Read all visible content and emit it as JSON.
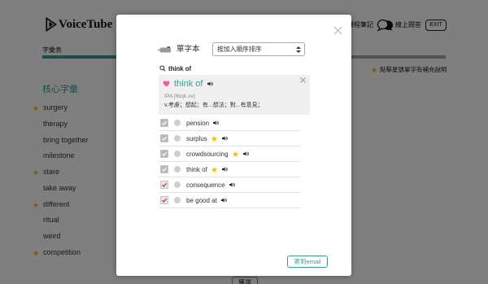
{
  "header": {
    "brand": "VoiceTube",
    "brand_icon": "voicetube-logo-icon",
    "nav_notes": "課程筆記",
    "nav_qa_icon": "chat-bubbles-icon",
    "nav_qa": "線上問答",
    "exit": "EXIT"
  },
  "tab": {
    "label": "字彙表",
    "progress": 0.25
  },
  "hint": {
    "icon": "star-icon",
    "text": "點擊星號單字有補充說明"
  },
  "core_vocab": {
    "title": "核心字彙",
    "items": [
      {
        "word": "surgery",
        "starred": true
      },
      {
        "word": "therapy",
        "starred": false
      },
      {
        "word": "bring together",
        "starred": false
      },
      {
        "word": "milestone",
        "starred": false
      },
      {
        "word": "stare",
        "starred": true
      },
      {
        "word": "take away",
        "starred": false
      },
      {
        "word": "different",
        "starred": true
      },
      {
        "word": "ritual",
        "starred": false
      },
      {
        "word": "weird",
        "starred": false
      },
      {
        "word": "competition",
        "starred": true
      }
    ]
  },
  "bottom_button": "獲選",
  "modal": {
    "close_icon": "close-icon",
    "title_icon": "marker-icon",
    "title": "單字本",
    "sort": {
      "selected": "按加入順序排序"
    },
    "search": {
      "icon": "search-icon",
      "query": "think of"
    },
    "definition": {
      "icon": "heart-icon",
      "word": "think of",
      "ipa": "IPA [θɪŋk ʌv]",
      "meaning": "v.考慮；想起；有...想法；對...有意見；"
    },
    "words": [
      {
        "word": "pension",
        "starred": false,
        "checked": true,
        "box_color": "#b8b8b8",
        "check_color": "#ffffff"
      },
      {
        "word": "surplus",
        "starred": true,
        "checked": true,
        "box_color": "#b8b8b8",
        "check_color": "#ffffff"
      },
      {
        "word": "crowdsourcing",
        "starred": true,
        "checked": true,
        "box_color": "#b8b8b8",
        "check_color": "#ffffff"
      },
      {
        "word": "think of",
        "starred": true,
        "checked": true,
        "box_color": "#b8b8b8",
        "check_color": "#ffffff"
      },
      {
        "word": "consequence",
        "starred": false,
        "checked": true,
        "box_color": "#e6e6e6",
        "check_color": "#c0392b"
      },
      {
        "word": "be good at",
        "starred": false,
        "checked": true,
        "box_color": "#e6e6e6",
        "check_color": "#c0392b"
      }
    ],
    "email_button": "寄到email"
  },
  "colors": {
    "accent": "#3a9b91",
    "star": "#f4c20d",
    "heart": "#ee5fa0",
    "selected_check": "#c0392b"
  }
}
